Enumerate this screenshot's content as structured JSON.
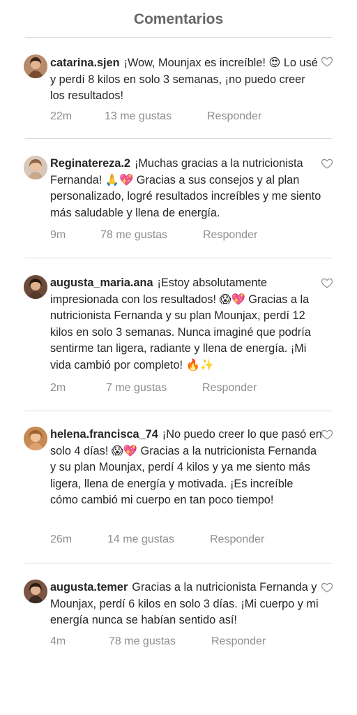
{
  "header": {
    "title": "Comentarios"
  },
  "comments": [
    {
      "username": "catarina.sjen",
      "text": "¡Wow, Mounjax es increíble! 😍 Lo usé y perdí 8 kilos en solo 3 semanas, ¡no puedo creer los resultados!",
      "time": "22m",
      "likes": "13 me gustas",
      "reply": "Responder"
    },
    {
      "username": "Reginatereza.2",
      "text": "¡Muchas gracias a la nutricionista Fernanda! 🙏💖 Gracias a sus consejos y al plan personalizado, logré resultados increíbles y me siento más saludable y llena de energía.",
      "time": "9m",
      "likes": "78 me gustas",
      "reply": "Responder"
    },
    {
      "username": "augusta_maria.ana",
      "text": "¡Estoy absolutamente impresionada con los resultados! 😱💖 Gracias a la nutricionista Fernanda y su plan Mounjax, perdí 12 kilos en solo 3 semanas. Nunca imaginé que podría sentirme tan ligera, radiante y llena de energía. ¡Mi vida cambió por completo! 🔥✨",
      "time": "2m",
      "likes": "7 me gustas",
      "reply": "Responder"
    },
    {
      "username": "helena.francisca_74",
      "text": "¡No puedo creer lo que pasó en solo 4 días! 😱💖 Gracias a la nutricionista Fernanda y su plan Mounjax, perdí 4 kilos y ya me siento más ligera, llena de energía y motivada. ¡Es increíble cómo cambió mi cuerpo en tan poco tiempo!",
      "time": "26m",
      "likes": "14 me gustas",
      "reply": "Responder"
    },
    {
      "username": "augusta.temer",
      "text": "Gracias a la nutricionista Fernanda y Mounjax, perdí 6 kilos en solo 3 días. ¡Mi cuerpo y mi energía nunca se habían sentido así!",
      "time": "4m",
      "likes": "78 me gustas",
      "reply": "Responder"
    }
  ],
  "icons": {
    "like": "heart-outline-icon"
  },
  "colors": {
    "muted": "#8e8e8e",
    "text": "#262626",
    "title": "#666666",
    "divider": "#d9d9d9"
  }
}
